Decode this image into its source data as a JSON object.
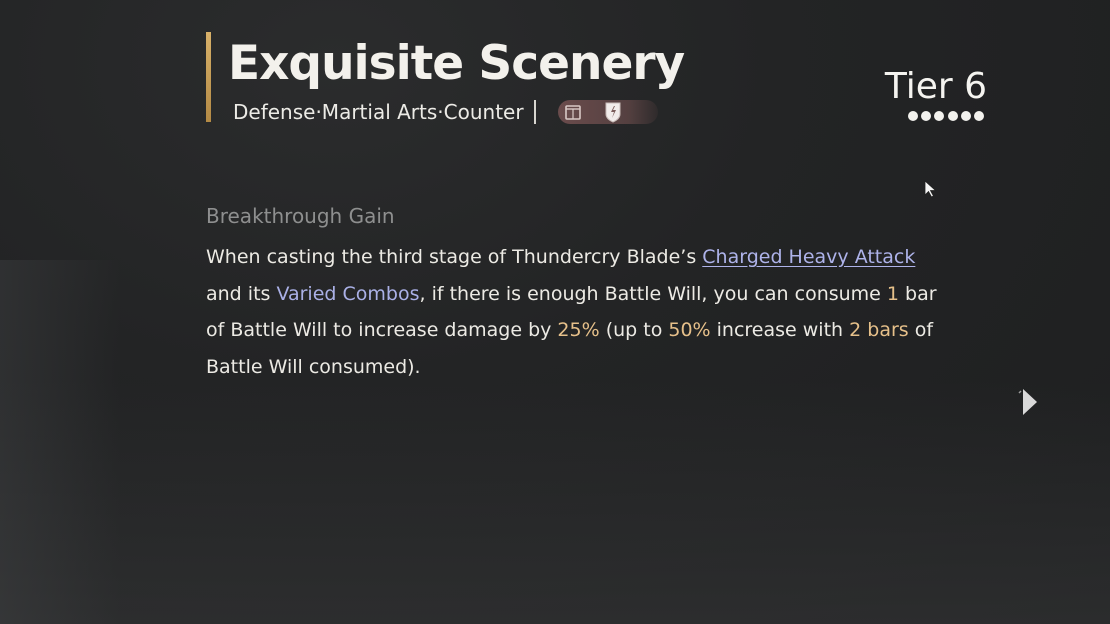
{
  "skill": {
    "title": "Exquisite Scenery",
    "tags": "Defense·Martial Arts·Counter",
    "tier_label": "Tier 6",
    "tier_level": 6,
    "tier_max": 6,
    "weapon_icons": [
      "fan-icon",
      "blade-icon"
    ]
  },
  "breakthrough": {
    "heading": "Breakthrough Gain",
    "line1_prefix": "When casting the third stage of Thundercry Blade’s ",
    "line1_link": "Charged Heavy Attack",
    "line2_prefix": "and its ",
    "line2_kw": "Varied Combos",
    "line2_mid": ", if there is enough Battle Will, you can consume ",
    "line2_num": "1",
    "line2_suffix": " bar",
    "line3_prefix": "of Battle Will to increase damage by ",
    "line3_num1": "25%",
    "line3_mid1": " (up to ",
    "line3_num2": "50%",
    "line3_mid2": " increase with ",
    "line3_num3": "2 bars",
    "line3_suffix": " of",
    "line4": "Battle Will consumed)."
  },
  "colors": {
    "accent_bar": "#d8b169",
    "keyword": "#aeb3ea",
    "number": "#e6c08a",
    "heading": "#8e8f8f"
  },
  "icons": {
    "cursor": "mouse-cursor-icon",
    "next": "next-arrow-icon"
  }
}
